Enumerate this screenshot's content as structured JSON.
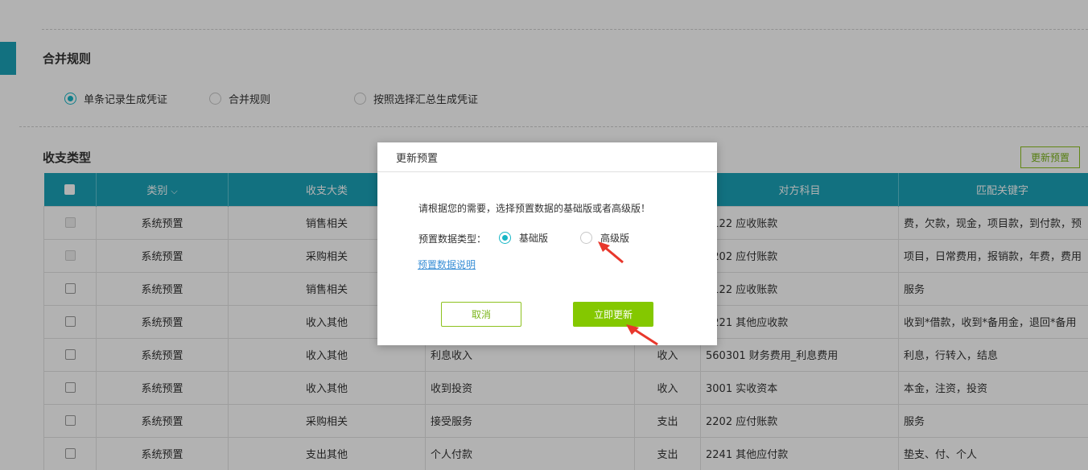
{
  "merge_section": {
    "title": "合并规则",
    "options": [
      {
        "label": "单条记录生成凭证",
        "selected": true
      },
      {
        "label": "合并规则",
        "selected": false
      },
      {
        "label": "按照选择汇总生成凭证",
        "selected": false
      }
    ]
  },
  "income_section": {
    "title": "收支类型",
    "update_button": "更新预置",
    "columns": [
      "类别",
      "收支大类",
      "",
      "",
      "对方科目",
      "匹配关键字"
    ],
    "rows": [
      {
        "category": "系统预置",
        "major": "销售相关",
        "name": "",
        "direction": "",
        "account": "1122 应收账款",
        "keywords": "费，欠款，现金，项目款，到付款，预",
        "disabled": true
      },
      {
        "category": "系统预置",
        "major": "采购相关",
        "name": "",
        "direction": "",
        "account": "2202 应付账款",
        "keywords": "项目，日常费用，报销款，年费，费用",
        "disabled": true
      },
      {
        "category": "系统预置",
        "major": "销售相关",
        "name": "",
        "direction": "",
        "account": "1122 应收账款",
        "keywords": "服务",
        "disabled": false
      },
      {
        "category": "系统预置",
        "major": "收入其他",
        "name": "",
        "direction": "",
        "account": "1221 其他应收款",
        "keywords": "收到*借款，收到*备用金，退回*备用",
        "disabled": false
      },
      {
        "category": "系统预置",
        "major": "收入其他",
        "name": "利息收入",
        "direction": "收入",
        "account": "560301 财务费用_利息费用",
        "keywords": "利息，行转入，结息",
        "disabled": false
      },
      {
        "category": "系统预置",
        "major": "收入其他",
        "name": "收到投资",
        "direction": "收入",
        "account": "3001 实收资本",
        "keywords": "本金，注资，投资",
        "disabled": false
      },
      {
        "category": "系统预置",
        "major": "采购相关",
        "name": "接受服务",
        "direction": "支出",
        "account": "2202 应付账款",
        "keywords": "服务",
        "disabled": false
      },
      {
        "category": "系统预置",
        "major": "支出其他",
        "name": "个人付款",
        "direction": "支出",
        "account": "2241 其他应付款",
        "keywords": "垫支、付、个人",
        "disabled": false
      }
    ]
  },
  "modal": {
    "title": "更新预置",
    "description": "请根据您的需要，选择预置数据的基础版或者高级版！",
    "type_label": "预置数据类型：",
    "options": [
      {
        "label": "基础版",
        "selected": true
      },
      {
        "label": "高级版",
        "selected": false
      }
    ],
    "link": "预置数据说明",
    "cancel": "取消",
    "confirm": "立即更新"
  },
  "colors": {
    "teal": "#1aa3b8",
    "green": "#84c800",
    "annotation_red": "#e8372c"
  }
}
